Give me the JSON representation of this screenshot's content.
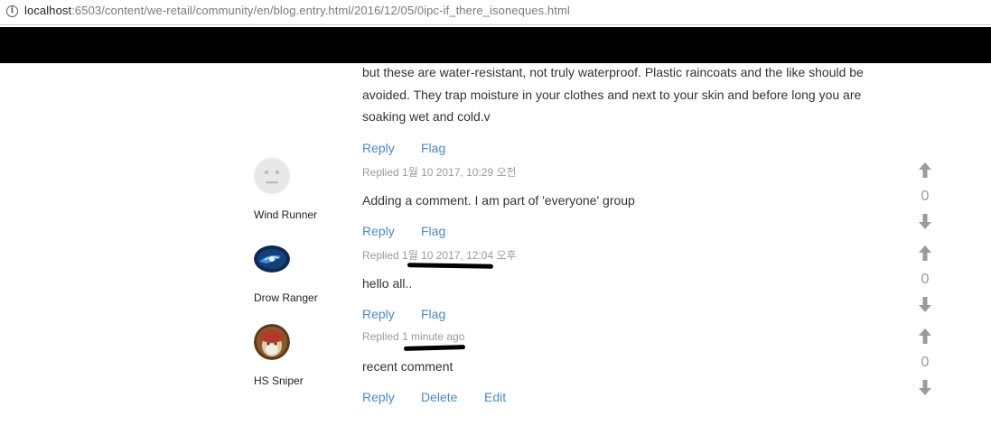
{
  "browser": {
    "url_host": "localhost",
    "url_rest": ":6503/content/we-retail/community/en/blog.entry.html/2016/12/05/0ipc-if_there_isoneques.html"
  },
  "post": {
    "text": "but these are water-resistant, not truly waterproof. Plastic raincoats and the like should be avoided. They trap moisture in your clothes and next to your skin and before long you are soaking wet and cold.v",
    "actions": {
      "reply": "Reply",
      "flag": "Flag"
    }
  },
  "comments": [
    {
      "user": "Wind Runner",
      "replied": "Replied 1월 10 2017, 10:29 오전",
      "text": "Adding a comment. I am part of 'everyone' group",
      "votes": "0",
      "actions": {
        "reply": "Reply",
        "flag": "Flag"
      }
    },
    {
      "user": "Drow Ranger",
      "replied": "Replied 1월 10 2017, 12:04 오후",
      "text": "hello all..",
      "votes": "0",
      "actions": {
        "reply": "Reply",
        "flag": "Flag"
      }
    },
    {
      "user": "HS Sniper",
      "replied": "Replied 1 minute ago",
      "text": "recent comment",
      "votes": "0",
      "actions": {
        "reply": "Reply",
        "delete": "Delete",
        "edit": "Edit"
      }
    }
  ],
  "icons": {
    "info": "info-icon",
    "upvote": "arrow-up-icon",
    "downvote": "arrow-down-icon"
  },
  "colors": {
    "link": "#4a89c8",
    "meta": "#9a9a9a",
    "vote": "#9a9a9a",
    "header_band": "#000000"
  }
}
